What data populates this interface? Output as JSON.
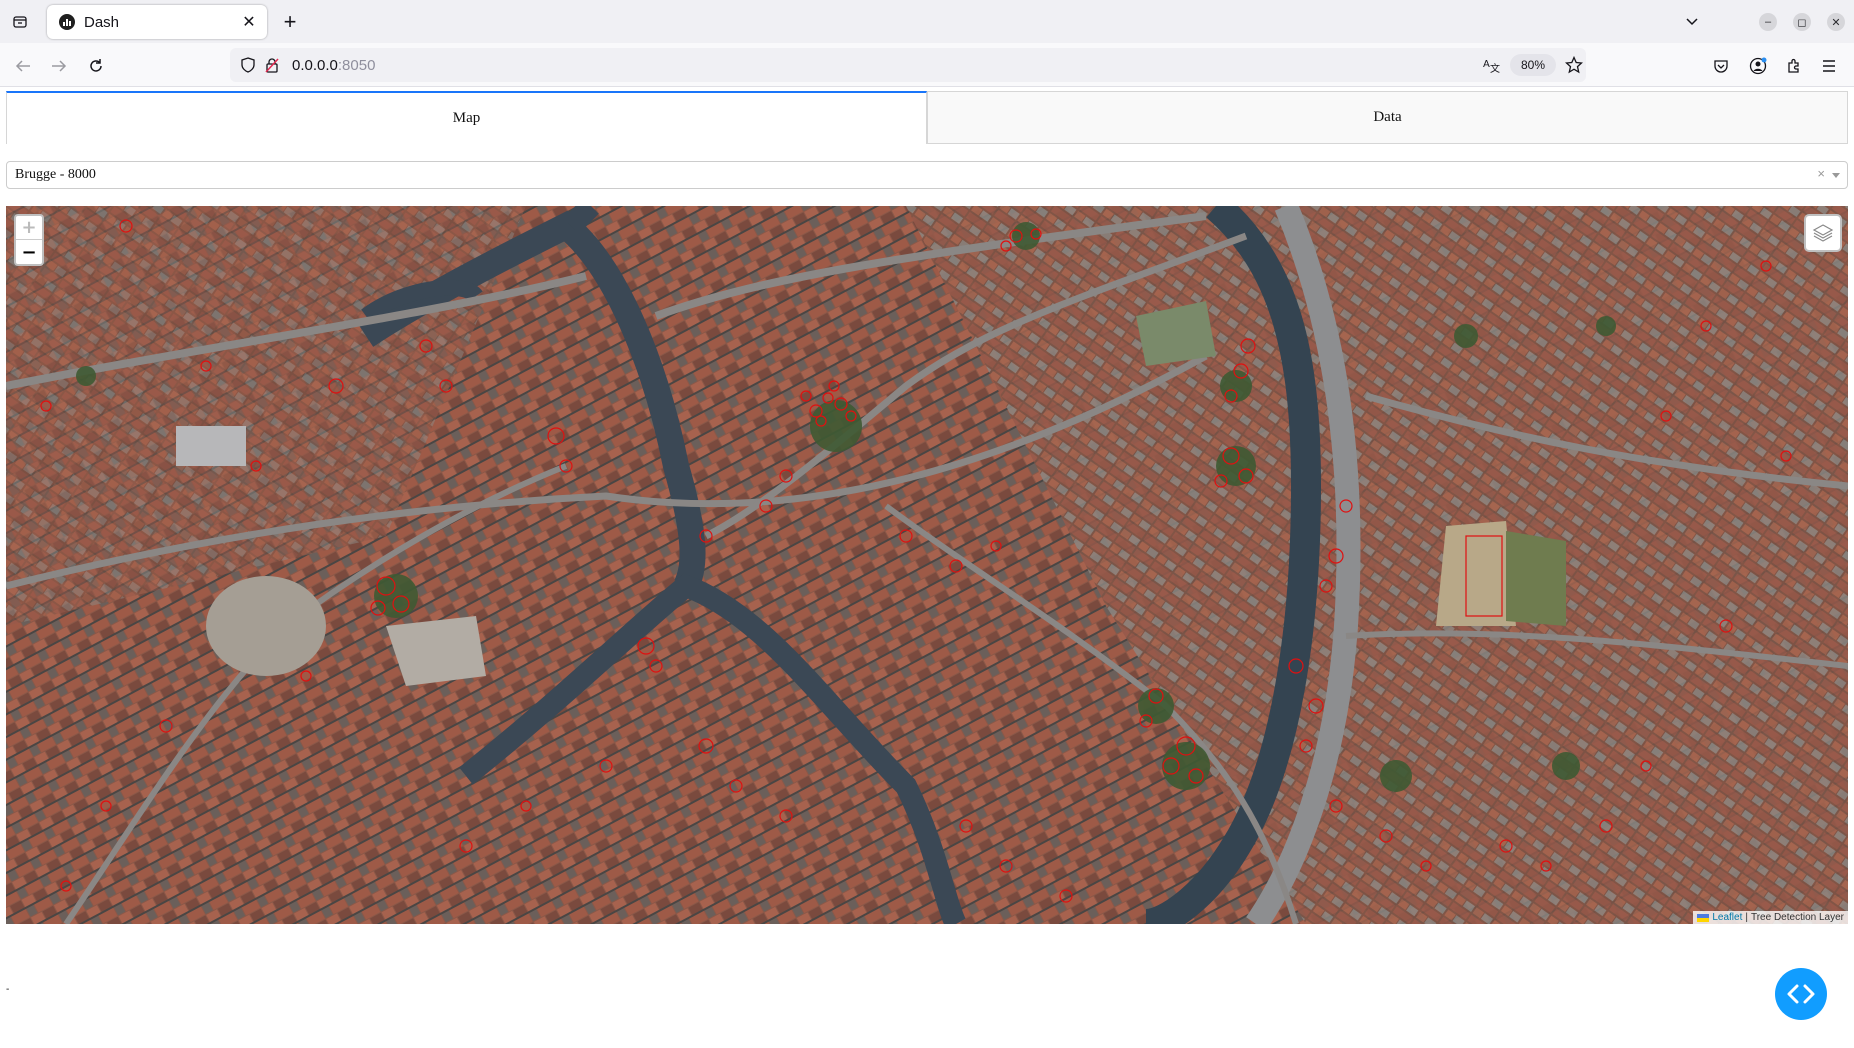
{
  "browser": {
    "tab_title": "Dash",
    "url_host": "0.0.0.0",
    "url_port": ":8050",
    "zoom_level": "80%"
  },
  "app": {
    "tabs": [
      {
        "label": "Map",
        "active": true
      },
      {
        "label": "Data",
        "active": false
      }
    ],
    "location_dropdown": {
      "selected": "Brugge - 8000",
      "clear_symbol": "×"
    },
    "map": {
      "zoom_in": "+",
      "zoom_out": "−",
      "attribution_link": "Leaflet",
      "attribution_separator": "|",
      "attribution_layer": "Tree Detection Layer",
      "overlay_color": "#e01010"
    },
    "footer_text": "-"
  },
  "colors": {
    "accent": "#1975fa",
    "debug_button": "#119dff"
  }
}
